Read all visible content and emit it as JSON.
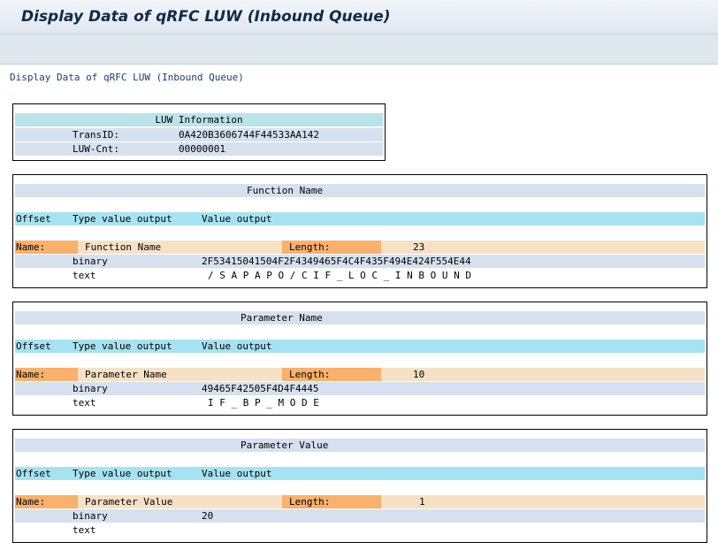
{
  "window": {
    "title": "Display Data of qRFC LUW (Inbound Queue)",
    "subtitle": "Display Data of qRFC LUW (Inbound Queue)"
  },
  "luw": {
    "header": "LUW Information",
    "transid_label": "TransID:",
    "transid_value": "0A420B3606744F44533AA142",
    "cnt_label": "LUW-Cnt:",
    "cnt_value": "00000001"
  },
  "sections": [
    {
      "title": "Function Name",
      "col_offset": "Offset",
      "col_type": "Type value output",
      "col_value": "Value output",
      "name_label": "Name:",
      "name_value": "Function Name",
      "length_label": "Length:",
      "length_value": "23",
      "binary_label": "binary",
      "binary_value": "2F53415041504F2F4349465F4C4F435F494E424F554E44",
      "text_label": "text",
      "text_value": "/ S A P A P O / C I F _ L O C _ I N B O U N D"
    },
    {
      "title": "Parameter Name",
      "col_offset": "Offset",
      "col_type": "Type value output",
      "col_value": "Value output",
      "name_label": "Name:",
      "name_value": "Parameter Name",
      "length_label": "Length:",
      "length_value": "10",
      "binary_label": "binary",
      "binary_value": "49465F42505F4D4F4445",
      "text_label": "text",
      "text_value": "I F _ B P _ M O D E"
    },
    {
      "title": "Parameter Value",
      "col_offset": "Offset",
      "col_type": "Type value output",
      "col_value": "Value output",
      "name_label": "Name:",
      "name_value": "Parameter Value",
      "length_label": "Length:",
      "length_value": "1",
      "binary_label": "binary",
      "binary_value": "20",
      "text_label": "text",
      "text_value": ""
    }
  ]
}
